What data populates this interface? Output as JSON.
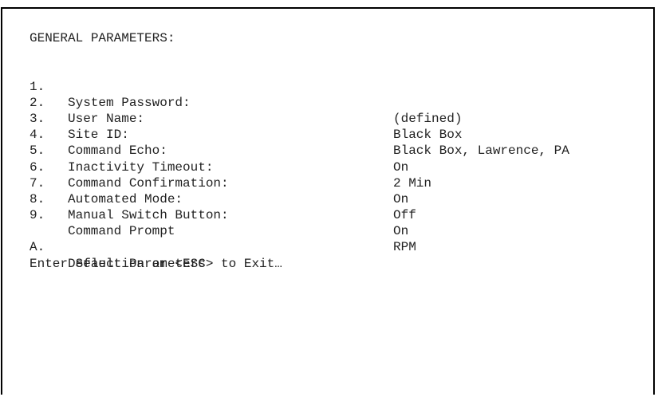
{
  "screen": {
    "title": "GENERAL PARAMETERS:",
    "options": [
      {
        "key": "1.",
        "label": "System Password:",
        "value": "(defined)"
      },
      {
        "key": "2.",
        "label": "User Name:",
        "value": "Black Box"
      },
      {
        "key": "3.",
        "label": "Site ID:",
        "value": "Black Box, Lawrence, PA"
      },
      {
        "key": "4.",
        "label": "Command Echo:",
        "value": "On"
      },
      {
        "key": "5.",
        "label": "Inactivity Timeout:",
        "value": "2 Min"
      },
      {
        "key": "6.",
        "label": "Command Confirmation:",
        "value": "On"
      },
      {
        "key": "7.",
        "label": "Automated Mode:",
        "value": "Off"
      },
      {
        "key": "8.",
        "label": "Manual Switch Button:",
        "value": "On"
      },
      {
        "key": "9.",
        "label": "Command Prompt",
        "value": "RPM"
      }
    ],
    "default_option": {
      "key": "A.",
      "label": "Default Parameters"
    },
    "prompt": "Enter Selection or <ESC> to Exit…"
  }
}
